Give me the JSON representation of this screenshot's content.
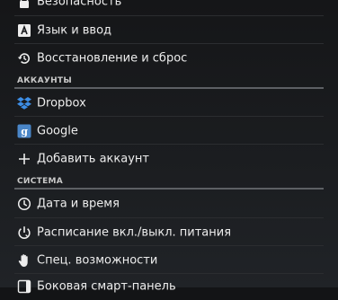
{
  "settings": {
    "items_top": [
      {
        "label": "Безопасность",
        "icon": "lock-icon"
      },
      {
        "label": "Язык и ввод",
        "icon": "keyboard-a-icon"
      },
      {
        "label": "Восстановление и сброс",
        "icon": "restore-icon"
      }
    ],
    "accounts_header": "АККАУНТЫ",
    "accounts": [
      {
        "label": "Dropbox",
        "icon": "dropbox-icon"
      },
      {
        "label": "Google",
        "icon": "google-icon"
      },
      {
        "label": "Добавить аккаунт",
        "icon": "plus-icon"
      }
    ],
    "system_header": "СИСТЕМА",
    "system": [
      {
        "label": "Дата и время",
        "icon": "clock-icon"
      },
      {
        "label": "Расписание вкл./выкл. питания",
        "icon": "power-schedule-icon"
      },
      {
        "label": "Спец. возможности",
        "icon": "hand-icon"
      },
      {
        "label": "Боковая смарт-панель",
        "icon": "side-panel-icon"
      }
    ]
  },
  "colors": {
    "background": "#18191c",
    "text": "#ededed",
    "header_text": "#c9c9c9",
    "dropbox_blue": "#3d8ee6",
    "google_blue": "#4a86c8"
  }
}
